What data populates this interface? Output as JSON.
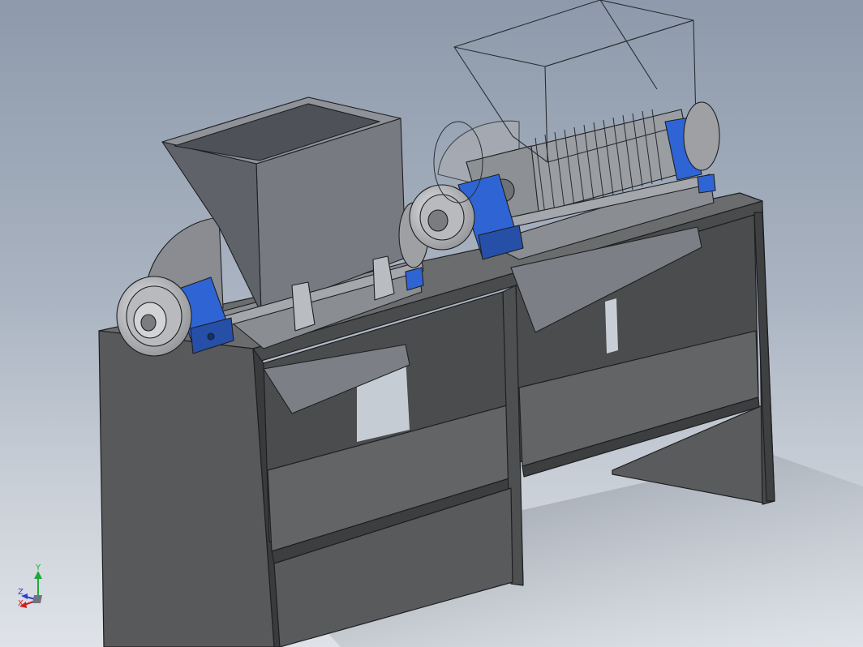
{
  "viewport": {
    "background_top": "#8e9aab",
    "background_bottom": "#dfe3e8"
  },
  "model": {
    "frame_color": "#5c5d5f",
    "bearing_color": "#2f64d4",
    "hopper_color": "#6b6e75",
    "transparent_hopper_stroke": "#2a2d33"
  },
  "triad": {
    "x_label": "X",
    "y_label": "Y",
    "z_label": "Z",
    "x_color": "#d21f1f",
    "y_color": "#1fa83a",
    "z_color": "#2d3fd6"
  }
}
